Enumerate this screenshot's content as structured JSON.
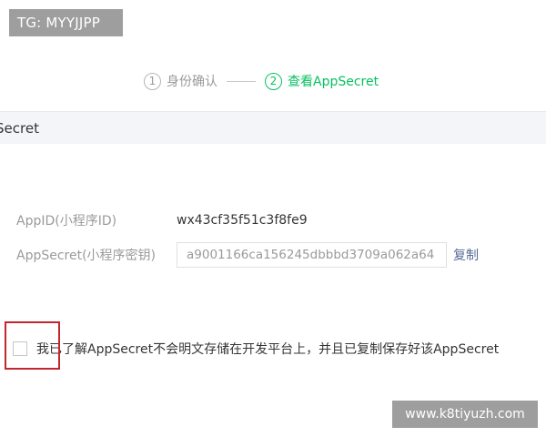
{
  "watermark_top": "TG: MYYJJPP",
  "steps": [
    {
      "num": "1",
      "label": "身份确认",
      "active": false
    },
    {
      "num": "2",
      "label": "查看AppSecret",
      "active": true
    }
  ],
  "section_title": "Secret",
  "appid": {
    "label": "AppID(小程序ID)",
    "value": "wx43cf35f51c3f8fe9"
  },
  "appsecret": {
    "label": "AppSecret(小程序密钥)",
    "value": "a9001166ca156245dbbbd3709a062a64",
    "copy_label": "复制"
  },
  "agreement_text": "我已了解AppSecret不会明文存储在开发平台上，并且已复制保存好该AppSecret",
  "watermark_bottom": "www.k8tiyuzh.com",
  "colors": {
    "accent": "#07c160",
    "link": "#576b95",
    "highlight": "#c1272d"
  }
}
